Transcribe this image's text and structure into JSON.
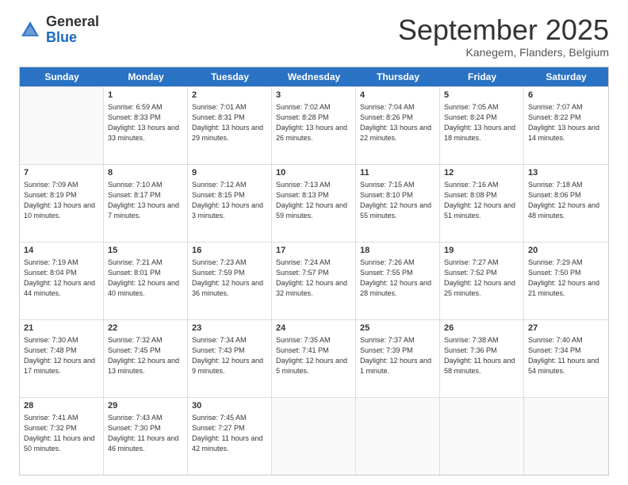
{
  "logo": {
    "general": "General",
    "blue": "Blue"
  },
  "title": "September 2025",
  "location": "Kanegem, Flanders, Belgium",
  "days": [
    "Sunday",
    "Monday",
    "Tuesday",
    "Wednesday",
    "Thursday",
    "Friday",
    "Saturday"
  ],
  "weeks": [
    [
      {
        "day": "",
        "sunrise": "",
        "sunset": "",
        "daylight": ""
      },
      {
        "day": "1",
        "sunrise": "Sunrise: 6:59 AM",
        "sunset": "Sunset: 8:33 PM",
        "daylight": "Daylight: 13 hours and 33 minutes."
      },
      {
        "day": "2",
        "sunrise": "Sunrise: 7:01 AM",
        "sunset": "Sunset: 8:31 PM",
        "daylight": "Daylight: 13 hours and 29 minutes."
      },
      {
        "day": "3",
        "sunrise": "Sunrise: 7:02 AM",
        "sunset": "Sunset: 8:28 PM",
        "daylight": "Daylight: 13 hours and 26 minutes."
      },
      {
        "day": "4",
        "sunrise": "Sunrise: 7:04 AM",
        "sunset": "Sunset: 8:26 PM",
        "daylight": "Daylight: 13 hours and 22 minutes."
      },
      {
        "day": "5",
        "sunrise": "Sunrise: 7:05 AM",
        "sunset": "Sunset: 8:24 PM",
        "daylight": "Daylight: 13 hours and 18 minutes."
      },
      {
        "day": "6",
        "sunrise": "Sunrise: 7:07 AM",
        "sunset": "Sunset: 8:22 PM",
        "daylight": "Daylight: 13 hours and 14 minutes."
      }
    ],
    [
      {
        "day": "7",
        "sunrise": "Sunrise: 7:09 AM",
        "sunset": "Sunset: 8:19 PM",
        "daylight": "Daylight: 13 hours and 10 minutes."
      },
      {
        "day": "8",
        "sunrise": "Sunrise: 7:10 AM",
        "sunset": "Sunset: 8:17 PM",
        "daylight": "Daylight: 13 hours and 7 minutes."
      },
      {
        "day": "9",
        "sunrise": "Sunrise: 7:12 AM",
        "sunset": "Sunset: 8:15 PM",
        "daylight": "Daylight: 13 hours and 3 minutes."
      },
      {
        "day": "10",
        "sunrise": "Sunrise: 7:13 AM",
        "sunset": "Sunset: 8:13 PM",
        "daylight": "Daylight: 12 hours and 59 minutes."
      },
      {
        "day": "11",
        "sunrise": "Sunrise: 7:15 AM",
        "sunset": "Sunset: 8:10 PM",
        "daylight": "Daylight: 12 hours and 55 minutes."
      },
      {
        "day": "12",
        "sunrise": "Sunrise: 7:16 AM",
        "sunset": "Sunset: 8:08 PM",
        "daylight": "Daylight: 12 hours and 51 minutes."
      },
      {
        "day": "13",
        "sunrise": "Sunrise: 7:18 AM",
        "sunset": "Sunset: 8:06 PM",
        "daylight": "Daylight: 12 hours and 48 minutes."
      }
    ],
    [
      {
        "day": "14",
        "sunrise": "Sunrise: 7:19 AM",
        "sunset": "Sunset: 8:04 PM",
        "daylight": "Daylight: 12 hours and 44 minutes."
      },
      {
        "day": "15",
        "sunrise": "Sunrise: 7:21 AM",
        "sunset": "Sunset: 8:01 PM",
        "daylight": "Daylight: 12 hours and 40 minutes."
      },
      {
        "day": "16",
        "sunrise": "Sunrise: 7:23 AM",
        "sunset": "Sunset: 7:59 PM",
        "daylight": "Daylight: 12 hours and 36 minutes."
      },
      {
        "day": "17",
        "sunrise": "Sunrise: 7:24 AM",
        "sunset": "Sunset: 7:57 PM",
        "daylight": "Daylight: 12 hours and 32 minutes."
      },
      {
        "day": "18",
        "sunrise": "Sunrise: 7:26 AM",
        "sunset": "Sunset: 7:55 PM",
        "daylight": "Daylight: 12 hours and 28 minutes."
      },
      {
        "day": "19",
        "sunrise": "Sunrise: 7:27 AM",
        "sunset": "Sunset: 7:52 PM",
        "daylight": "Daylight: 12 hours and 25 minutes."
      },
      {
        "day": "20",
        "sunrise": "Sunrise: 7:29 AM",
        "sunset": "Sunset: 7:50 PM",
        "daylight": "Daylight: 12 hours and 21 minutes."
      }
    ],
    [
      {
        "day": "21",
        "sunrise": "Sunrise: 7:30 AM",
        "sunset": "Sunset: 7:48 PM",
        "daylight": "Daylight: 12 hours and 17 minutes."
      },
      {
        "day": "22",
        "sunrise": "Sunrise: 7:32 AM",
        "sunset": "Sunset: 7:45 PM",
        "daylight": "Daylight: 12 hours and 13 minutes."
      },
      {
        "day": "23",
        "sunrise": "Sunrise: 7:34 AM",
        "sunset": "Sunset: 7:43 PM",
        "daylight": "Daylight: 12 hours and 9 minutes."
      },
      {
        "day": "24",
        "sunrise": "Sunrise: 7:35 AM",
        "sunset": "Sunset: 7:41 PM",
        "daylight": "Daylight: 12 hours and 5 minutes."
      },
      {
        "day": "25",
        "sunrise": "Sunrise: 7:37 AM",
        "sunset": "Sunset: 7:39 PM",
        "daylight": "Daylight: 12 hours and 1 minute."
      },
      {
        "day": "26",
        "sunrise": "Sunrise: 7:38 AM",
        "sunset": "Sunset: 7:36 PM",
        "daylight": "Daylight: 11 hours and 58 minutes."
      },
      {
        "day": "27",
        "sunrise": "Sunrise: 7:40 AM",
        "sunset": "Sunset: 7:34 PM",
        "daylight": "Daylight: 11 hours and 54 minutes."
      }
    ],
    [
      {
        "day": "28",
        "sunrise": "Sunrise: 7:41 AM",
        "sunset": "Sunset: 7:32 PM",
        "daylight": "Daylight: 11 hours and 50 minutes."
      },
      {
        "day": "29",
        "sunrise": "Sunrise: 7:43 AM",
        "sunset": "Sunset: 7:30 PM",
        "daylight": "Daylight: 11 hours and 46 minutes."
      },
      {
        "day": "30",
        "sunrise": "Sunrise: 7:45 AM",
        "sunset": "Sunset: 7:27 PM",
        "daylight": "Daylight: 11 hours and 42 minutes."
      },
      {
        "day": "",
        "sunrise": "",
        "sunset": "",
        "daylight": ""
      },
      {
        "day": "",
        "sunrise": "",
        "sunset": "",
        "daylight": ""
      },
      {
        "day": "",
        "sunrise": "",
        "sunset": "",
        "daylight": ""
      },
      {
        "day": "",
        "sunrise": "",
        "sunset": "",
        "daylight": ""
      }
    ]
  ]
}
